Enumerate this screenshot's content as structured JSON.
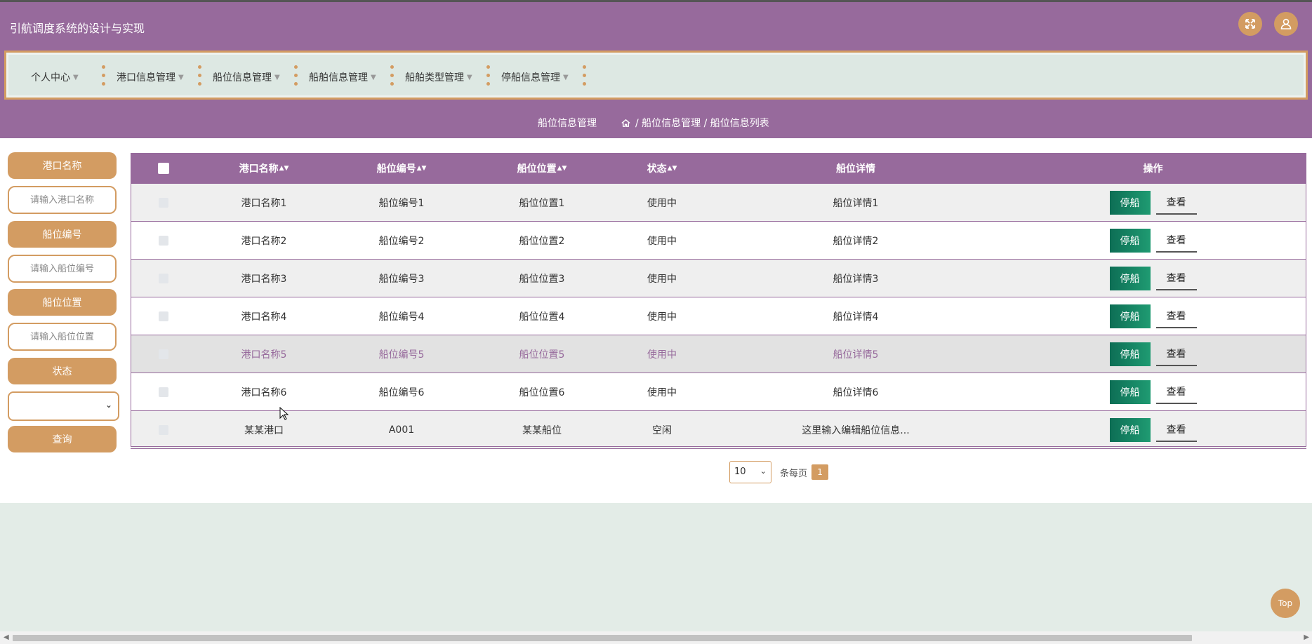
{
  "app": {
    "title": "引航调度系统的设计与实现"
  },
  "header": {
    "fullscreen_icon": "fullscreen-icon",
    "user_icon": "user-icon"
  },
  "nav": {
    "items": [
      {
        "label": "个人中心"
      },
      {
        "label": "港口信息管理"
      },
      {
        "label": "船位信息管理"
      },
      {
        "label": "船舶信息管理"
      },
      {
        "label": "船舶类型管理"
      },
      {
        "label": "停船信息管理"
      }
    ]
  },
  "breadcrumb": {
    "title": "船位信息管理",
    "path": "/ 船位信息管理 / 船位信息列表"
  },
  "search": {
    "port_label": "港口名称",
    "port_placeholder": "请输入港口名称",
    "berth_no_label": "船位编号",
    "berth_no_placeholder": "请输入船位编号",
    "berth_loc_label": "船位位置",
    "berth_loc_placeholder": "请输入船位位置",
    "status_label": "状态",
    "status_value": "",
    "query_label": "查询"
  },
  "table": {
    "columns": [
      "港口名称",
      "船位编号",
      "船位位置",
      "状态",
      "船位详情",
      "操作"
    ],
    "dock_label": "停船",
    "view_label": "查看",
    "rows": [
      {
        "port": "港口名称1",
        "no": "船位编号1",
        "loc": "船位位置1",
        "status": "使用中",
        "detail": "船位详情1"
      },
      {
        "port": "港口名称2",
        "no": "船位编号2",
        "loc": "船位位置2",
        "status": "使用中",
        "detail": "船位详情2"
      },
      {
        "port": "港口名称3",
        "no": "船位编号3",
        "loc": "船位位置3",
        "status": "使用中",
        "detail": "船位详情3"
      },
      {
        "port": "港口名称4",
        "no": "船位编号4",
        "loc": "船位位置4",
        "status": "使用中",
        "detail": "船位详情4"
      },
      {
        "port": "港口名称5",
        "no": "船位编号5",
        "loc": "船位位置5",
        "status": "使用中",
        "detail": "船位详情5"
      },
      {
        "port": "港口名称6",
        "no": "船位编号6",
        "loc": "船位位置6",
        "status": "使用中",
        "detail": "船位详情6"
      },
      {
        "port": "某某港口",
        "no": "A001",
        "loc": "某某船位",
        "status": "空闲",
        "detail": "这里输入编辑船位信息..."
      }
    ]
  },
  "pager": {
    "page_size": "10",
    "per_page_label": "条每页",
    "current_page": "1"
  },
  "top_button": "Top",
  "colors": {
    "primary": "#976a9c",
    "accent": "#d39c62",
    "dock": "#0d6e55",
    "bg": "#e3ece7"
  }
}
